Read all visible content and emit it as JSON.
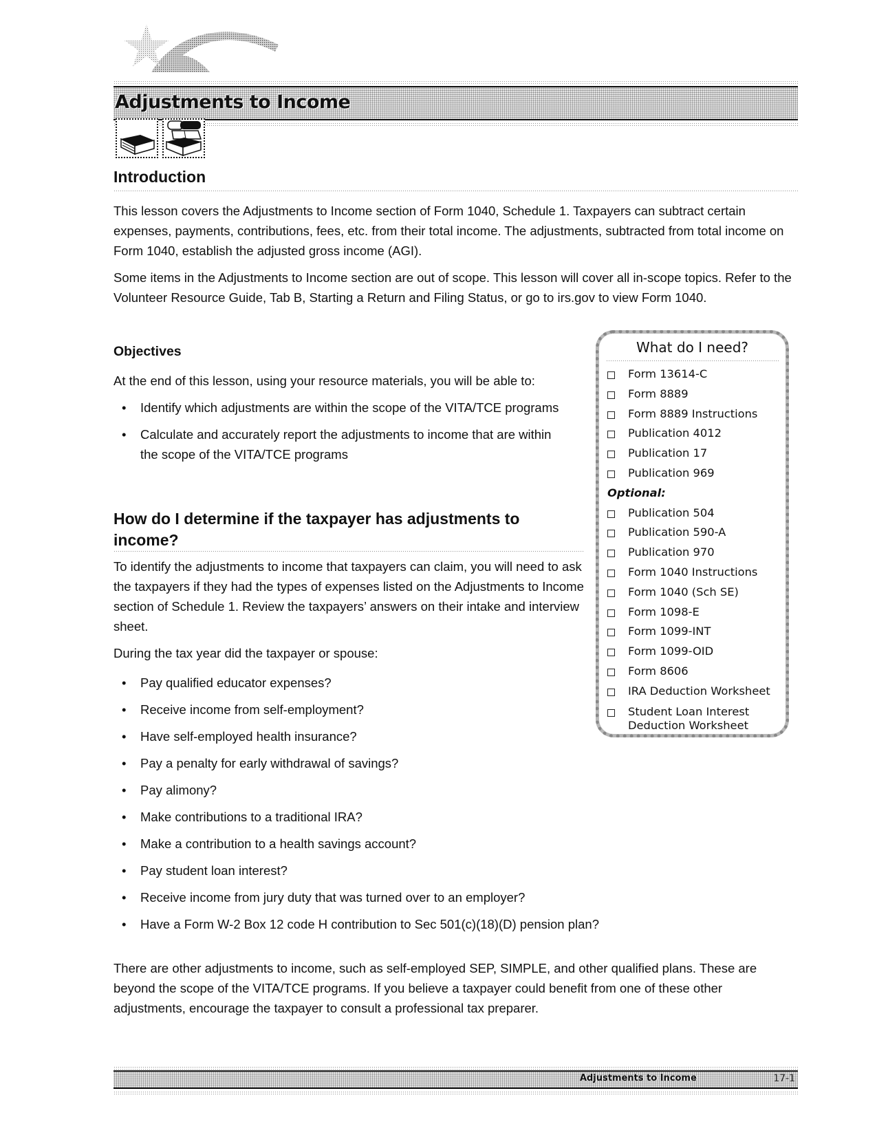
{
  "header": {
    "title": "Adjustments to Income",
    "logo_icon": "star-swoosh-icon"
  },
  "icons": [
    {
      "name": "single-book-icon"
    },
    {
      "name": "stacked-books-icon"
    }
  ],
  "introduction": {
    "heading": "Introduction",
    "paragraphs": [
      "This lesson covers the Adjustments to Income section of Form 1040, Schedule 1. Taxpayers can subtract certain expenses, payments, contributions, fees, etc. from their total income. The adjustments, subtracted from total income on Form 1040, establish the adjusted gross income (AGI).",
      "Some items in the Adjustments to Income section are out of scope. This lesson will cover all in-scope topics. Refer to the Volunteer Resource Guide, Tab B, Starting a Return and Filing Status, or go to irs.gov to view Form 1040."
    ]
  },
  "objectives": {
    "heading": "Objectives",
    "lead": "At the end of this lesson, using your resource materials, you will be able to:",
    "items": [
      "Identify which adjustments are within the scope of the VITA/TCE programs",
      "Calculate and accurately report the adjustments to income that are within the scope of the VITA/TCE programs"
    ]
  },
  "determine": {
    "heading": "How do I determine if the taxpayer has adjustments to income?",
    "paragraph": "To identify the adjustments to income that taxpayers can claim, you will need to ask the taxpayers if they had the types of expenses listed on the Adjustments to Income section of Schedule 1. Review the taxpayers’ answers on their intake and interview sheet.",
    "lead": "During the tax year did the taxpayer or spouse:",
    "questions": [
      "Pay qualified educator expenses?",
      "Receive income from self-employment?",
      "Have self-employed health insurance?",
      "Pay a penalty for early withdrawal of savings?",
      "Pay alimony?",
      "Make contributions to a traditional IRA?",
      "Make a contribution to a health savings account?",
      "Pay student loan interest?",
      "Receive income from jury duty that was turned over to an employer?",
      "Have a Form W-2 Box 12 code H contribution to Sec 501(c)(18)(D) pension plan?"
    ],
    "closing": "There are other adjustments to income, such as self-employed SEP, SIMPLE, and other qualified plans. These are beyond the scope of the VITA/TCE programs. If you believe a taxpayer could benefit from one of these other adjustments, encourage the taxpayer to consult a professional tax preparer."
  },
  "need_box": {
    "title": "What do I need?",
    "required": [
      "Form 13614-C",
      "Form 8889",
      "Form 8889 Instructions",
      "Publication 4012",
      "Publication 17",
      "Publication 969"
    ],
    "optional_label": "Optional:",
    "optional": [
      "Publication 504",
      "Publication 590-A",
      "Publication 970",
      "Form 1040 Instructions",
      "Form 1040 (Sch SE)",
      "Form 1098-E",
      "Form 1099-INT",
      "Form 1099-OID",
      "Form 8606",
      "IRA Deduction Worksheet",
      "Student Loan Interest Deduction Worksheet"
    ]
  },
  "footer": {
    "title": "Adjustments to Income",
    "page": "17-1"
  }
}
